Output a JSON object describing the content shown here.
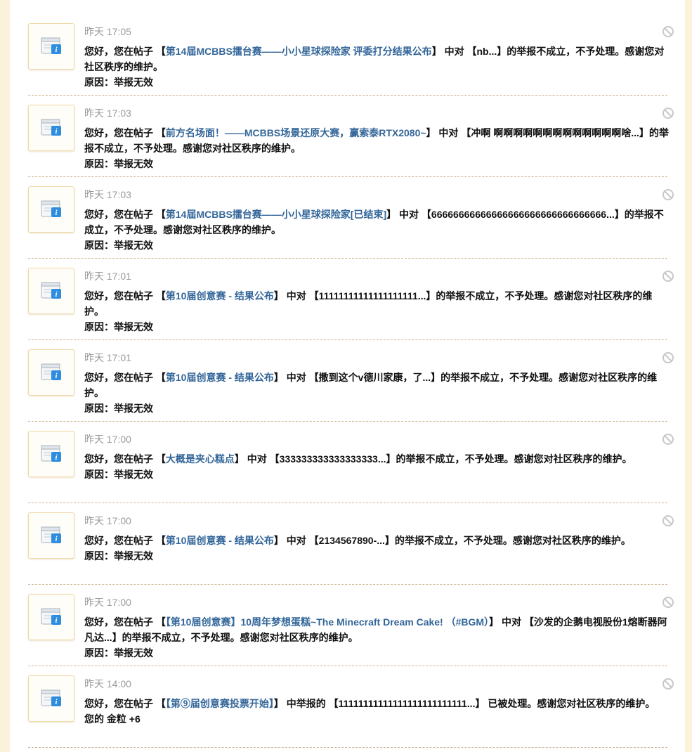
{
  "notices": [
    {
      "time": "昨天 17:05",
      "prefix": "您好，您在帖子 【",
      "thread_link": "第14届MCBBS擂台赛——小小星球探险家 评委打分结果公布",
      "middle": "】 中对 【nb...】的举报不成立，不予处理。感谢您对社区秩序的维护。",
      "reason": "原因：举报无效"
    },
    {
      "time": "昨天 17:03",
      "prefix": "您好，您在帖子 【",
      "thread_link": "前方名场面！——MCBBS场景还原大赛，赢索泰RTX2080~",
      "middle": "】 中对 【冲啊 啊啊啊啊啊啊啊啊啊啊啊啊啊啥...】的举报不成立，不予处理。感谢您对社区秩序的维护。",
      "reason": "原因：举报无效"
    },
    {
      "time": "昨天 17:03",
      "prefix": "您好，您在帖子 【",
      "thread_link": "第14届MCBBS擂台赛——小小星球探险家[已结束]",
      "middle": "】 中对 【66666666666666666666666666666666...】的举报不成立，不予处理。感谢您对社区秩序的维护。",
      "reason": "原因：举报无效"
    },
    {
      "time": "昨天 17:01",
      "prefix": "您好，您在帖子 【",
      "thread_link": "第10届创意赛 - 结果公布",
      "middle": "】 中对 【11111111111111111111...】的举报不成立，不予处理。感谢您对社区秩序的维护。",
      "reason": "原因：举报无效"
    },
    {
      "time": "昨天 17:01",
      "prefix": "您好，您在帖子 【",
      "thread_link": "第10届创意赛 - 结果公布",
      "middle": "】 中对 【撒到这个v德川家康，了...】的举报不成立，不予处理。感谢您对社区秩序的维护。",
      "reason": "原因：举报无效"
    },
    {
      "time": "昨天 17:00",
      "prefix": "您好，您在帖子 【",
      "thread_link": "大概是夹心糕点",
      "middle": "】 中对 【333333333333333333...】的举报不成立，不予处理。感谢您对社区秩序的维护。",
      "reason": "原因：举报无效"
    },
    {
      "time": "昨天 17:00",
      "prefix": "您好，您在帖子 【",
      "thread_link": "第10届创意赛 - 结果公布",
      "middle": "】 中对 【2134567890-...】的举报不成立，不予处理。感谢您对社区秩序的维护。",
      "reason": "原因：举报无效"
    },
    {
      "time": "昨天 17:00",
      "prefix": "您好，您在帖子 【",
      "thread_link": "【第10届创意赛】10周年梦想蛋糕~The Minecraft Dream Cake! （#BGM）",
      "middle": "】 中对 【沙发的企鹅电视股份1熔断器阿凡达...】的举报不成立，不予处理。感谢您对社区秩序的维护。",
      "reason": "原因：举报无效"
    },
    {
      "time": "昨天 14:00",
      "prefix": "您好，您在帖子 【",
      "thread_link": "【第⑨届创意赛投票开始】",
      "middle": "】 中举报的 【11111111111111111111111111...】 已被处理。感谢您对社区秩序的维护。",
      "reason": "您的 金粒 +6"
    }
  ]
}
